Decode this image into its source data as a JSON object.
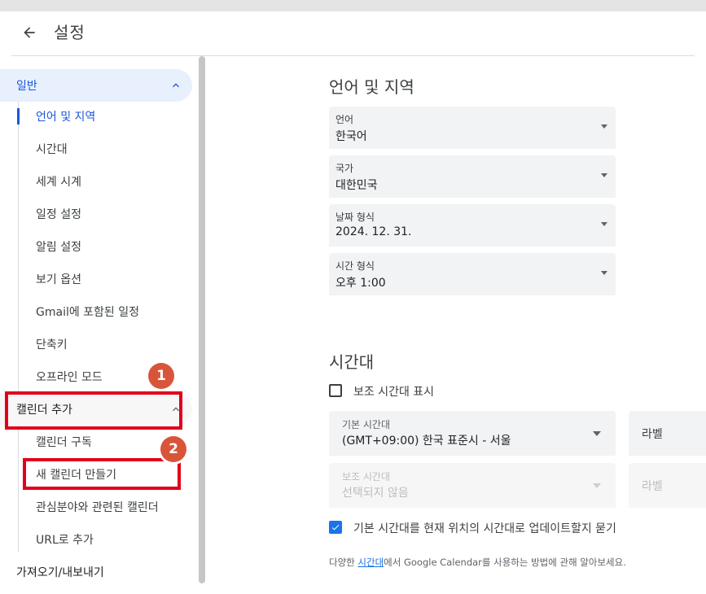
{
  "header": {
    "title": "설정"
  },
  "sidebar": {
    "group_general": "일반",
    "items_general": [
      {
        "label": "언어 및 지역"
      },
      {
        "label": "시간대"
      },
      {
        "label": "세계 시계"
      },
      {
        "label": "일정 설정"
      },
      {
        "label": "알림 설정"
      },
      {
        "label": "보기 옵션"
      },
      {
        "label": "Gmail에 포함된 일정"
      },
      {
        "label": "단축키"
      },
      {
        "label": "오프라인 모드"
      }
    ],
    "group_add_calendar": "캘린더 추가",
    "items_add_calendar": [
      {
        "label": "캘린더 구독"
      },
      {
        "label": "새 캘린더 만들기"
      },
      {
        "label": "관심분야와 관련된 캘린더"
      },
      {
        "label": "URL로 추가"
      }
    ],
    "group_import_export": "가져오기/내보내기"
  },
  "annotations": {
    "badge1": "1",
    "badge2": "2",
    "highlight_color": "#e0001a",
    "badge_color": "#d9553a"
  },
  "language_region": {
    "title": "언어 및 지역",
    "fields": [
      {
        "label": "언어",
        "value": "한국어"
      },
      {
        "label": "국가",
        "value": "대한민국"
      },
      {
        "label": "날짜 형식",
        "value": "2024. 12. 31."
      },
      {
        "label": "시간 형식",
        "value": "오후 1:00"
      }
    ]
  },
  "timezone": {
    "title": "시간대",
    "secondary_checkbox_label": "보조 시간대 표시",
    "secondary_checked": false,
    "primary_label": "기본 시간대",
    "primary_value": "(GMT+09:00) 한국 표준시 - 서울",
    "primary_tag_label": "라벨",
    "secondary_label": "보조 시간대",
    "secondary_value": "선택되지 않음",
    "secondary_tag_label": "라벨",
    "update_checkbox_label": "기본 시간대를 현재 위치의 시간대로 업데이트할지 묻기",
    "update_checked": true,
    "footer_prefix": "다양한 ",
    "footer_link": "시간대",
    "footer_suffix": "에서 Google Calendar를 사용하는 방법에 관해 알아보세요."
  },
  "colors": {
    "accent": "#1a73e8",
    "active_nav_bg": "#e8f0fe"
  }
}
